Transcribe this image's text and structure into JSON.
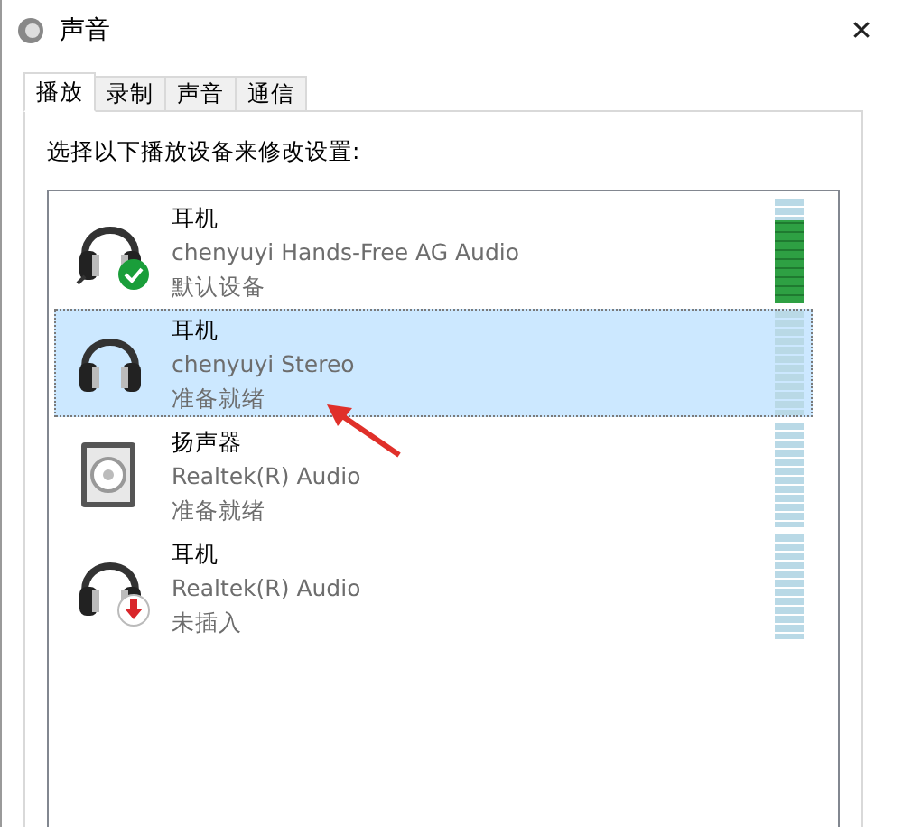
{
  "window": {
    "title": "声音",
    "close": "✕"
  },
  "tabs": [
    {
      "label": "播放",
      "selected": true
    },
    {
      "label": "录制",
      "selected": false
    },
    {
      "label": "声音",
      "selected": false
    },
    {
      "label": "通信",
      "selected": false
    }
  ],
  "instruction": "选择以下播放设备来修改设置:",
  "devices": [
    {
      "kind": "headset",
      "default": true,
      "unplugged": false,
      "name": "耳机",
      "description": "chenyuyi Hands-Free AG Audio",
      "status": "默认设备",
      "selected": false,
      "level": 0.8
    },
    {
      "kind": "headphones",
      "default": false,
      "unplugged": false,
      "name": "耳机",
      "description": "chenyuyi Stereo",
      "status": "准备就绪",
      "selected": true,
      "level": 0
    },
    {
      "kind": "speaker",
      "default": false,
      "unplugged": false,
      "name": "扬声器",
      "description": "Realtek(R) Audio",
      "status": "准备就绪",
      "selected": false,
      "level": 0
    },
    {
      "kind": "headphones",
      "default": false,
      "unplugged": true,
      "name": "耳机",
      "description": "Realtek(R) Audio",
      "status": "未插入",
      "selected": false,
      "level": 0
    }
  ]
}
